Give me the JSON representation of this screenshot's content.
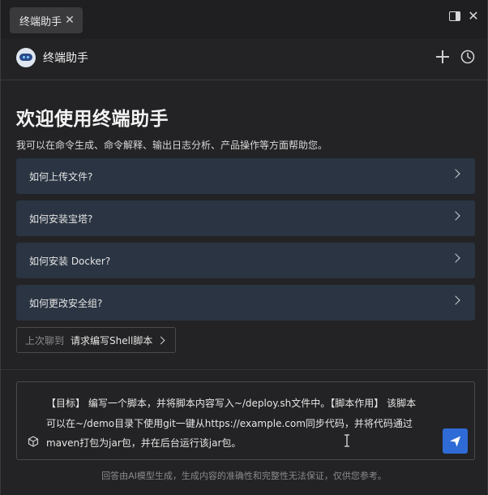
{
  "tab": {
    "title": "终端助手"
  },
  "header": {
    "title": "终端助手"
  },
  "main": {
    "welcome_title": "欢迎使用终端助手",
    "welcome_desc": "我可以在命令生成、命令解释、输出日志分析、产品操作等方面帮助您。",
    "suggestions": [
      {
        "label": "如何上传文件?"
      },
      {
        "label": "如何安装宝塔?"
      },
      {
        "label": "如何安装 Docker?"
      },
      {
        "label": "如何更改安全组?"
      }
    ],
    "last_chat": {
      "label": "上次聊到",
      "topic": "请求编写Shell脚本"
    }
  },
  "input": {
    "lines": [
      "【目标】 编写一个脚本，并将脚本内容写入~/deploy.sh文件中。【脚本作用】 该脚本",
      "可以在~/demo目录下使用git一键从https://example.com同步代码，并将代码通过",
      "maven打包为jar包，并在后台运行该jar包。"
    ]
  },
  "footer": {
    "note": "回答由AI模型生成，生成内容的准确性和完整性无法保证，仅供您参考。"
  },
  "colors": {
    "accent": "#2f6bd6",
    "suggestion_bg": "#2a3442",
    "background": "#232325"
  }
}
